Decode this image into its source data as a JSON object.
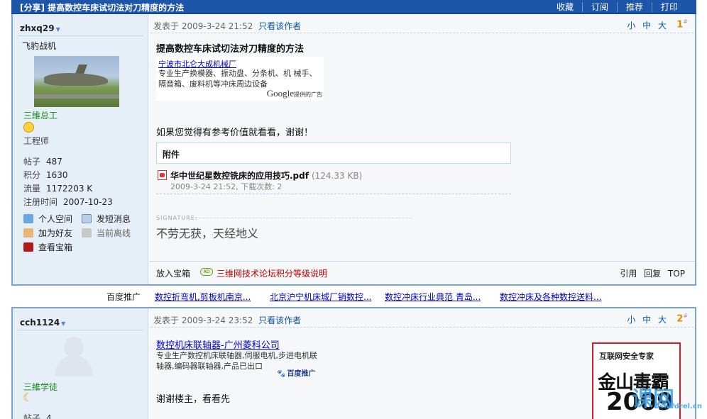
{
  "topbar": {
    "tag": "[分享]",
    "title": "提高数控车床试切法对刀精度的方法",
    "actions": [
      "收藏",
      "订阅",
      "推荐",
      "打印"
    ]
  },
  "post1": {
    "username": "zhxq29",
    "nickname": "飞豹战机",
    "rank": "三維总工",
    "title": "工程师",
    "stats": [
      {
        "label": "帖子",
        "value": "487"
      },
      {
        "label": "积分",
        "value": "1630"
      },
      {
        "label": "流量",
        "value": "1172203 K"
      },
      {
        "label": "注册时间",
        "value": "2007-10-23"
      }
    ],
    "links": [
      "个人空间",
      "发短消息",
      "加为好友",
      "当前离线",
      "查看宝箱"
    ],
    "posted_prefix": "发表于",
    "posted_time": "2009-3-24 21:52",
    "author_only": "只看该作者",
    "font_sizes": "小 中 大",
    "floor": "1",
    "floor_sup": "#",
    "post_title": "提高数控车床试切法对刀精度的方法",
    "google_ad": {
      "link": "宁波市北仑大成机械厂",
      "desc": "专业生产换模器、振动盘、分条机、机 械手、隔音箱、废料机等冲床周边设备",
      "brand": "Google",
      "brand_suffix": "提供的广告"
    },
    "body": "如果您觉得有参考价值就看看，谢谢！",
    "attachment_header": "附件",
    "attachment_name": "华中世纪星数控铣床的应用技巧.pdf",
    "attachment_size": "(124.33 KB)",
    "attachment_meta": "2009-3-24 21:52, 下载次数: 2",
    "signature_label": "SIGNATURE:",
    "signature": "不劳无获，天经地义",
    "footer_box": "放入宝箱",
    "footer_ad_icon": "AD",
    "footer_level": "三维网技术论坛积分等级说明",
    "footer_ops": "引用 回复 TOP"
  },
  "baidu_row": {
    "label": "百度推广",
    "links": [
      "数控折弯机,剪板机南京...",
      "北京沪宁机床城厂销数控...",
      "数控冲床行业典范 青岛...",
      "数控冲床及各种数控送料..."
    ]
  },
  "post2": {
    "username": "cch1124",
    "rank": "三維学徒",
    "stats": [
      {
        "label": "帖子",
        "value": "4"
      }
    ],
    "posted_prefix": "发表于",
    "posted_time": "2009-3-24 23:52",
    "author_only": "只看该作者",
    "font_sizes": "小 中 大",
    "floor": "2",
    "floor_sup": "#",
    "ad_link": "数控机床联轴器-广州菱科公司",
    "ad_desc": "专业生产数控机床联轴器,伺服电机,步进电机联轴器,编码器联轴器,产品已出口",
    "baidu_logo": "百度推广",
    "body": "谢谢楼主，看看先",
    "banner_title": "互联网安全专家",
    "banner_brand": "金山毒霸",
    "banner_year": "2009",
    "watermark": "课网",
    "watermark_url": "osoffdrel.cn"
  }
}
